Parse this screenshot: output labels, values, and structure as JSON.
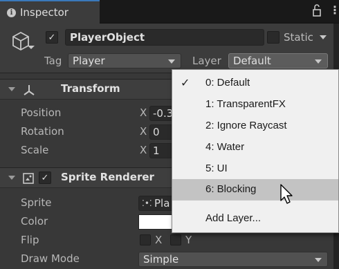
{
  "tab": {
    "title": "Inspector",
    "info_icon": "i"
  },
  "object": {
    "name": "PlayerObject",
    "static_label": "Static",
    "tag_label": "Tag",
    "tag_value": "Player",
    "layer_label": "Layer",
    "layer_value": "Default"
  },
  "transform": {
    "title": "Transform",
    "rows": [
      {
        "label": "Position",
        "axis": "X",
        "value": "-0.3"
      },
      {
        "label": "Rotation",
        "axis": "X",
        "value": "0"
      },
      {
        "label": "Scale",
        "axis": "X",
        "value": "1"
      }
    ]
  },
  "sprite_renderer": {
    "title": "Sprite Renderer",
    "sprite_label": "Sprite",
    "sprite_value": "Pla",
    "color_label": "Color",
    "color_value": "#ffffff",
    "flip_label": "Flip",
    "flip_x": "X",
    "flip_y": "Y",
    "draw_mode_label": "Draw Mode",
    "draw_mode_value": "Simple"
  },
  "layer_menu": {
    "items": [
      {
        "label": "0: Default",
        "checked": true
      },
      {
        "label": "1: TransparentFX"
      },
      {
        "label": "2: Ignore Raycast"
      },
      {
        "label": "4: Water"
      },
      {
        "label": "5: UI"
      },
      {
        "label": "6: Blocking",
        "highlighted": true
      }
    ],
    "add_layer": "Add Layer..."
  }
}
